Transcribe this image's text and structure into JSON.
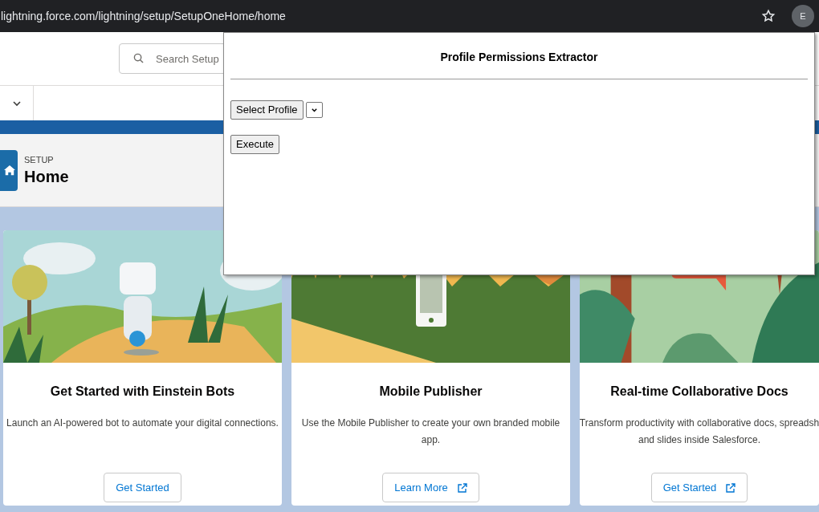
{
  "browser": {
    "url": "lightning.force.com/lightning/setup/SetupOneHome/home",
    "avatar": "E"
  },
  "header": {
    "search": {
      "placeholder": "Search Setup"
    }
  },
  "page_header": {
    "eyebrow": "SETUP",
    "title": "Home"
  },
  "cards": [
    {
      "title": "Get Started with Einstein Bots",
      "description_lines": [
        "Launch an AI-powered bot to automate your digital connections."
      ],
      "button": {
        "label": "Get Started",
        "external": false
      }
    },
    {
      "title": "Mobile Publisher",
      "description_lines": [
        "Use the Mobile Publisher to create your own branded mobile",
        "app."
      ],
      "button": {
        "label": "Learn More",
        "external": true
      }
    },
    {
      "title": "Real-time Collaborative Docs",
      "description_lines": [
        "Transform productivity with collaborative docs, spreadsh",
        "and slides inside Salesforce."
      ],
      "button": {
        "label": "Get Started",
        "external": true
      }
    }
  ],
  "popup": {
    "title": "Profile Permissions Extractor",
    "select_button": "Select Profile",
    "execute_button": "Execute"
  }
}
